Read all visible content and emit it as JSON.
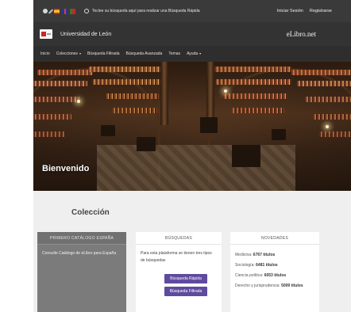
{
  "topbar": {
    "icons": [
      "globe-icon",
      "pencil-icon",
      "flag-es-icon",
      "flag-gb-icon",
      "flag-pt-icon",
      "search-icon"
    ],
    "search_hint": "Teclee su búsqueda aquí para realizar una Búsqueda Rápida",
    "login": "Iniciar Sesión",
    "register": "Registrarse"
  },
  "header": {
    "institution": "Universidad de León",
    "brand": "eLibro.net"
  },
  "nav": {
    "items": [
      {
        "label": "Inicio",
        "dropdown": false
      },
      {
        "label": "Colecciones",
        "dropdown": true
      },
      {
        "label": "Búsqueda Filtrada",
        "dropdown": false
      },
      {
        "label": "Búsqueda Avanzada",
        "dropdown": false
      },
      {
        "label": "Temas",
        "dropdown": false
      },
      {
        "label": "Ayuda",
        "dropdown": true
      }
    ],
    "caret": "▾"
  },
  "hero": {
    "title": "Bienvenido"
  },
  "collection": {
    "title": "Colección",
    "primary": {
      "heading": "PRIMERO CATÁLOGO ESPAÑA",
      "text": "Consulte Catálogo de eLibro para España"
    },
    "search": {
      "heading": "BÚSQUEDAS",
      "text": "Para esta plataforma se tienen tres tipos de búsquedas",
      "buttons": [
        "Búsqueda Rápida",
        "Búsqueda Filtrada"
      ]
    },
    "news": {
      "heading": "NOVEDADES",
      "items": [
        {
          "label": "Medicina:",
          "count": "6767 títulos"
        },
        {
          "label": "Sociología:",
          "count": "6481 títulos"
        },
        {
          "label": "Ciencia política:",
          "count": "6053 títulos"
        },
        {
          "label": "Derecho y jurisprudencia:",
          "count": "5009 títulos"
        }
      ]
    }
  },
  "colors": {
    "topbar_bg": "#3a3a3a",
    "header_bg": "#333333",
    "nav_bg": "#2e2e2e",
    "button_accent": "#5e4a9e",
    "panel_gray": "#7b7b7b",
    "content_bg": "#efefef"
  }
}
